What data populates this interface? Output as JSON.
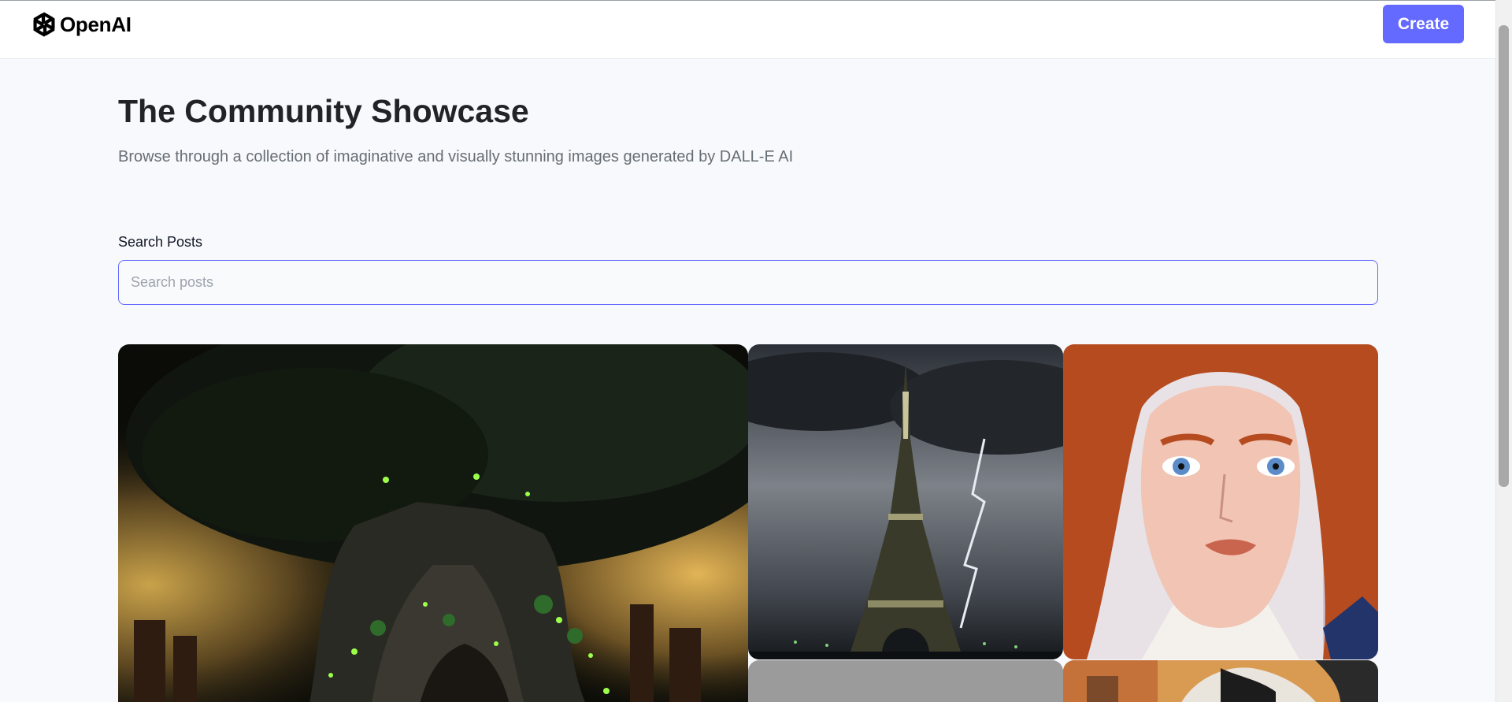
{
  "header": {
    "brand": "OpenAI",
    "create_label": "Create"
  },
  "main": {
    "title": "The Community Showcase",
    "subtitle": "Browse through a collection of imaginative and visually stunning images generated by DALL-E AI",
    "search": {
      "label": "Search Posts",
      "placeholder": "Search posts",
      "value": ""
    }
  },
  "gallery": {
    "cards": [
      {
        "name": "glowing-tree-image"
      },
      {
        "name": "eiffel-tower-storm-image"
      },
      {
        "name": "red-haired-woman-image"
      },
      {
        "name": "placeholder-gray-image"
      },
      {
        "name": "cat-painting-image"
      }
    ]
  },
  "colors": {
    "accent": "#6469ff",
    "title": "#222328",
    "subtitle": "#666e75",
    "background": "#f8f9fc"
  },
  "icons": {
    "brand_logo": "openai-logo-icon"
  }
}
